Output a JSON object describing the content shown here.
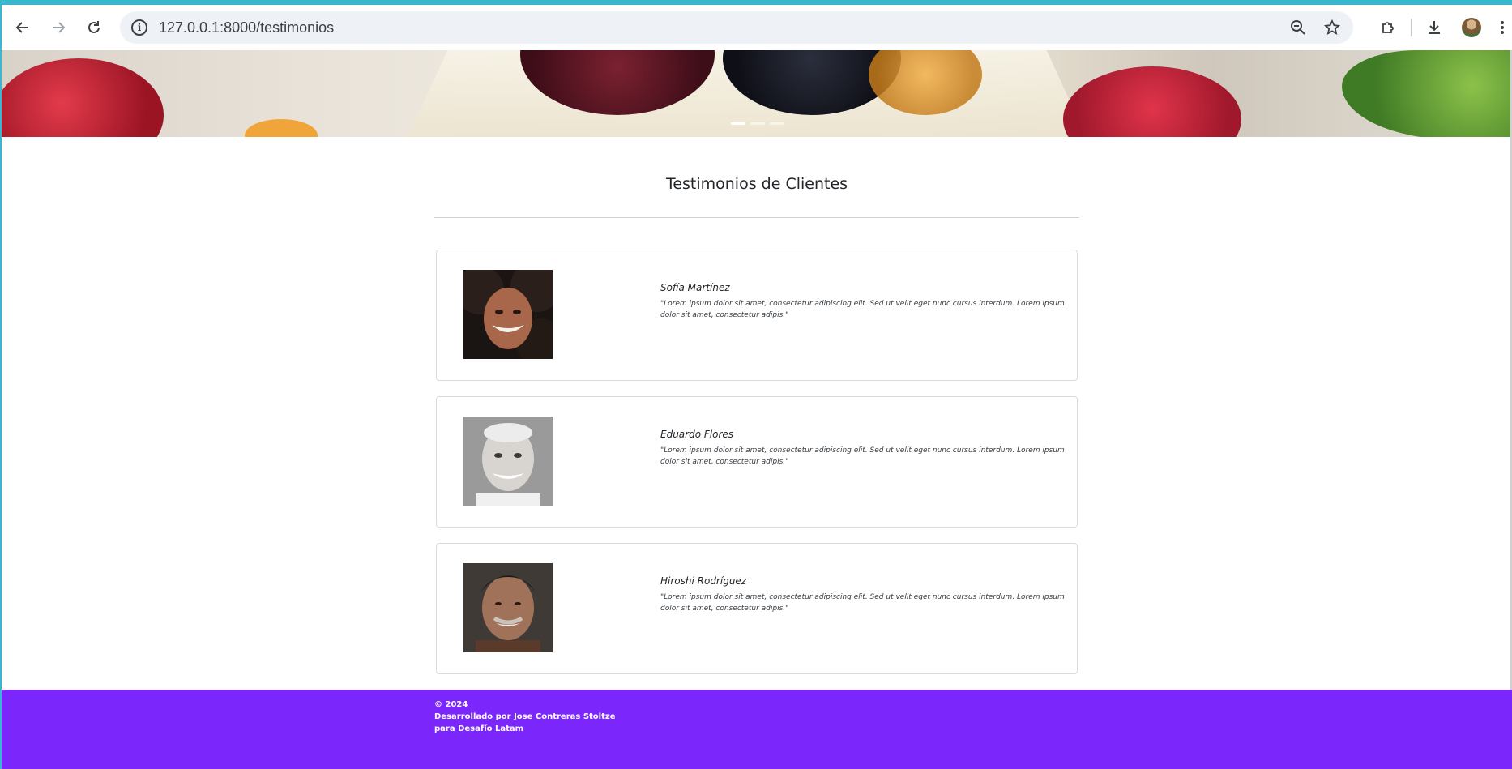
{
  "browser": {
    "url": "127.0.0.1:8000/testimonios",
    "icons": [
      "back-arrow-icon",
      "forward-arrow-icon",
      "reload-icon",
      "site-info-icon",
      "zoom-icon",
      "bookmark-star-icon",
      "extensions-icon",
      "download-icon",
      "profile-avatar",
      "more-menu-icon"
    ]
  },
  "hero": {
    "slides": 3,
    "active_slide": 1
  },
  "page": {
    "title": "Testimonios de Clientes"
  },
  "testimonials": [
    {
      "name": "Sofía Martínez",
      "quote": "\"Lorem ipsum dolor sit amet, consectetur adipiscing elit. Sed ut velit eget nunc cursus interdum. Lorem ipsum dolor sit amet, consectetur adipis.\""
    },
    {
      "name": "Eduardo Flores",
      "quote": "\"Lorem ipsum dolor sit amet, consectetur adipiscing elit. Sed ut velit eget nunc cursus interdum. Lorem ipsum dolor sit amet, consectetur adipis.\""
    },
    {
      "name": "Hiroshi Rodríguez",
      "quote": "\"Lorem ipsum dolor sit amet, consectetur adipiscing elit. Sed ut velit eget nunc cursus interdum. Lorem ipsum dolor sit amet, consectetur adipis.\""
    }
  ],
  "footer": {
    "line1": "© 2024",
    "line2": "Desarrollado por Jose Contreras Stoltze",
    "line3": "para Desafío Latam"
  },
  "colors": {
    "accent_top": "#3bb6cf",
    "footer_bg": "#7b27fb"
  }
}
